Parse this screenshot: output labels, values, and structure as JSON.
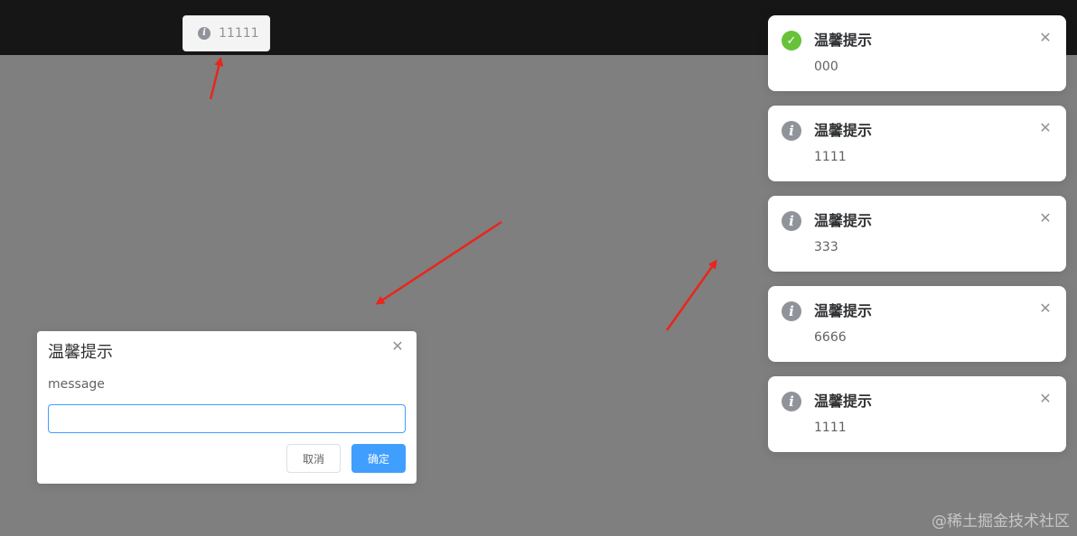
{
  "message_toast": {
    "text": "11111",
    "icon": "info-icon"
  },
  "notifications": [
    {
      "title": "温馨提示",
      "body": "000",
      "icon": "success-icon",
      "color": "#67c23a"
    },
    {
      "title": "温馨提示",
      "body": "1111",
      "icon": "info-icon",
      "color": "#909399"
    },
    {
      "title": "温馨提示",
      "body": "333",
      "icon": "info-icon",
      "color": "#909399"
    },
    {
      "title": "温馨提示",
      "body": "6666",
      "icon": "info-icon",
      "color": "#909399"
    },
    {
      "title": "温馨提示",
      "body": "1111",
      "icon": "info-icon",
      "color": "#909399"
    }
  ],
  "message_box": {
    "title": "温馨提示",
    "message": "message",
    "input_value": "",
    "cancel_label": "取消",
    "confirm_label": "确定"
  },
  "icons": {
    "close": "close-icon"
  },
  "watermark": "@稀土掘金技术社区",
  "colors": {
    "primary": "#409eff",
    "success": "#67c23a",
    "info": "#909399",
    "arrow": "#e8261c",
    "topbar": "#161616",
    "overlay": "#7f7f7f"
  }
}
